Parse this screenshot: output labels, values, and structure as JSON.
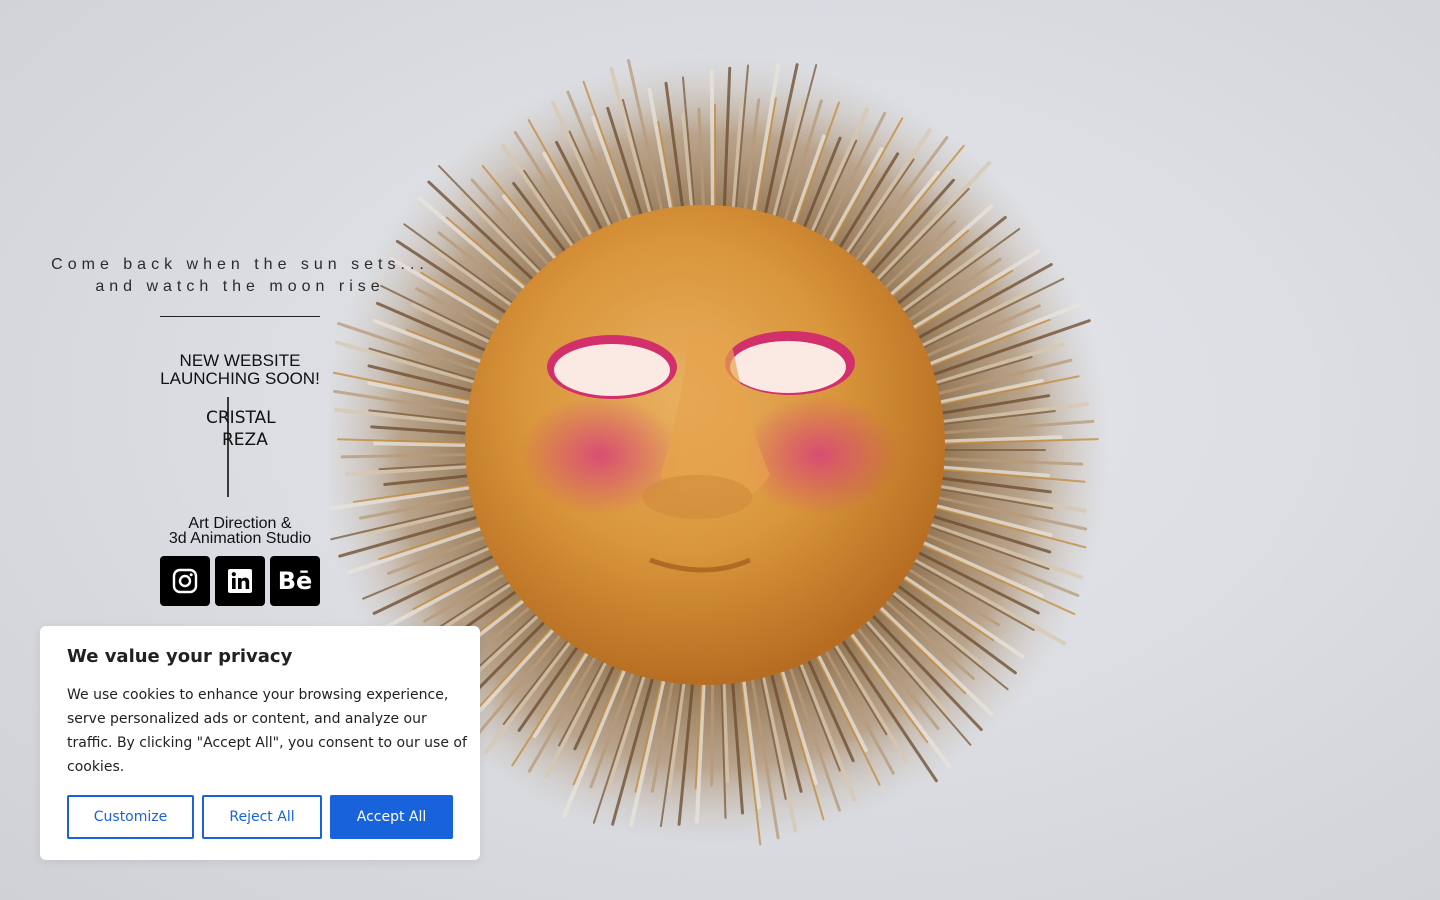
{
  "hero": {
    "tagline_line1": "Come back when the sun sets...",
    "tagline_line2": "and watch the moon rise",
    "launch_line1": "NEW WEBSITE",
    "launch_line2": "LAUNCHING SOON!",
    "signature_line1": "CRISTAL",
    "signature_line2": "REZA",
    "studio_line1": "Art Direction &",
    "studio_line2": "3d Animation Studio"
  },
  "social": [
    {
      "name": "instagram-icon"
    },
    {
      "name": "linkedin-icon"
    },
    {
      "name": "behance-icon",
      "glyph": "Bē"
    }
  ],
  "cookie_banner": {
    "title": "We value your privacy",
    "body": "We use cookies to enhance your browsing experience, serve personalized ads or content, and analyze our traffic. By clicking \"Accept All\", you consent to our use of cookies.",
    "customize_label": "Customize",
    "reject_label": "Reject All",
    "accept_label": "Accept All"
  },
  "colors": {
    "accent": "#1863dc",
    "background": "#dcdee3"
  }
}
